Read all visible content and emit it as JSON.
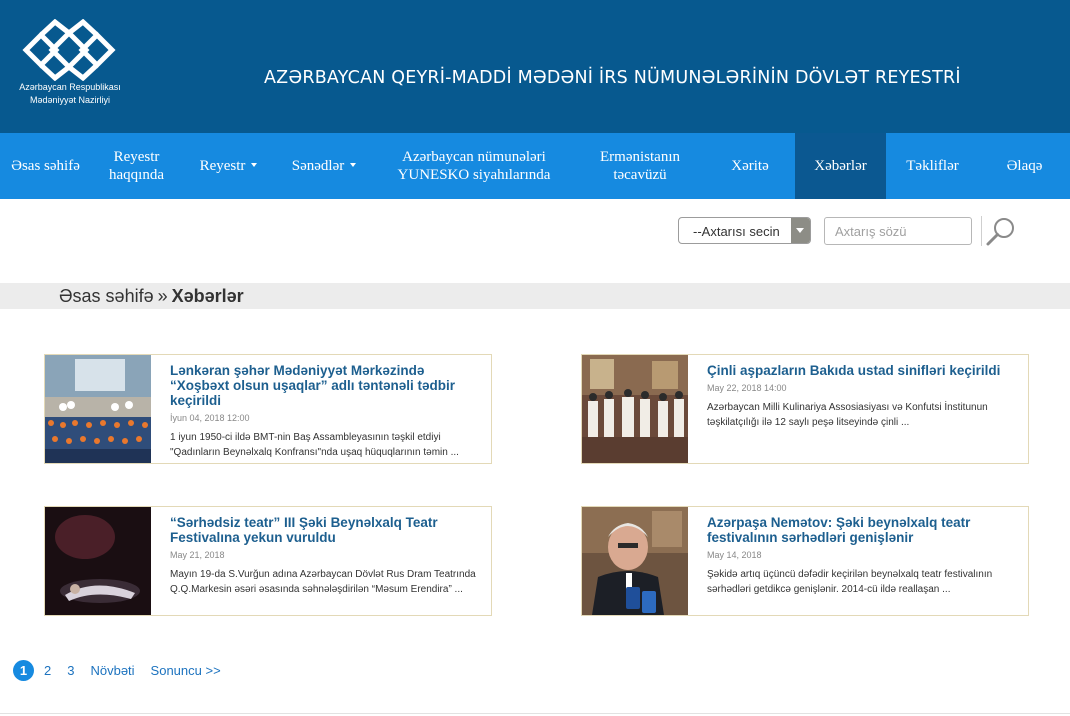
{
  "header": {
    "org_line1": "Azərbaycan Respublikası",
    "org_line2": "Mədəniyyət Nazirliyi",
    "title": "AZƏRBAYCAN QEYRİ-MADDİ MƏDƏNİ İRS NÜMUNƏLƏRİNİN DÖVLƏT REYESTRİ",
    "colors": {
      "header_bg": "#07598f",
      "nav_bg": "#168ae0",
      "nav_active_bg": "#0b5891"
    }
  },
  "nav": {
    "items": [
      {
        "line1": "Əsas səhifə",
        "line2": ""
      },
      {
        "line1": "Reyestr",
        "line2": "haqqında"
      },
      {
        "line1": "Reyestr",
        "line2": ""
      },
      {
        "line1": "Sənədlər",
        "line2": ""
      },
      {
        "line1": "Azərbaycan nümunələri",
        "line2": "YUNESKO siyahılarında"
      },
      {
        "line1": "Ermənistanın",
        "line2": "təcavüzü"
      },
      {
        "line1": "Xəritə",
        "line2": ""
      },
      {
        "line1": "Xəbərlər",
        "line2": ""
      },
      {
        "line1": "Təkliflər",
        "line2": ""
      },
      {
        "line1": "Əlaqə",
        "line2": ""
      }
    ],
    "active": "Xəbərlər"
  },
  "search": {
    "select_value": "--Axtarısı secin",
    "input_placeholder": "Axtarış sözü",
    "button_icon": "search-icon"
  },
  "breadcrumb": {
    "home": "Əsas səhifə",
    "separator": "»",
    "current": "Xəbərlər"
  },
  "news": [
    {
      "title": "Lənkəran şəhər Mədəniyyət Mərkəzində “Xoşbəxt olsun uşaqlar” adlı təntənəli tədbir keçirildi",
      "date": "İyun 04, 2018 12:00",
      "desc": "1 iyun 1950-ci ildə BMT-nin Baş Assambleyasının təşkil etdiyi \"Qadınların Beynəlxalq Konfransı\"nda uşaq hüquqlarının təmin ..."
    },
    {
      "title": "Çinli aşpazların Bakıda ustad sinifləri keçirildi",
      "date": "May 22, 2018 14:00",
      "desc": "Azərbaycan Milli Kulinariya Assosiasiyası və Konfutsi İnstitunun təşkilatçılığı ilə 12 saylı peşə litseyində çinli ..."
    },
    {
      "title": "“Sərhədsiz teatr” III Şəki Beynəlxalq Teatr Festivalına yekun vuruldu",
      "date": "May 21, 2018",
      "desc": "Mayın 19-da S.Vurğun adına Azərbaycan Dövlət Rus Dram Teatrında Q.Q.Markesin əsəri əsasında səhnələşdirilən “Məsum Erendira” ..."
    },
    {
      "title": "Azərpaşa Nemətov: Şəki beynəlxalq teatr festivalının sərhədləri genişlənir",
      "date": "May 14, 2018",
      "desc": "Şəkidə artıq üçüncü dəfədir keçirilən beynəlxalq teatr festivalının sərhədləri getdikcə genişlənir. 2014-cü ildə reallaşan ..."
    }
  ],
  "pagination": {
    "pages": [
      "1",
      "2",
      "3"
    ],
    "current": "1",
    "next": "Növbəti",
    "last": "Sonuncu >>"
  }
}
